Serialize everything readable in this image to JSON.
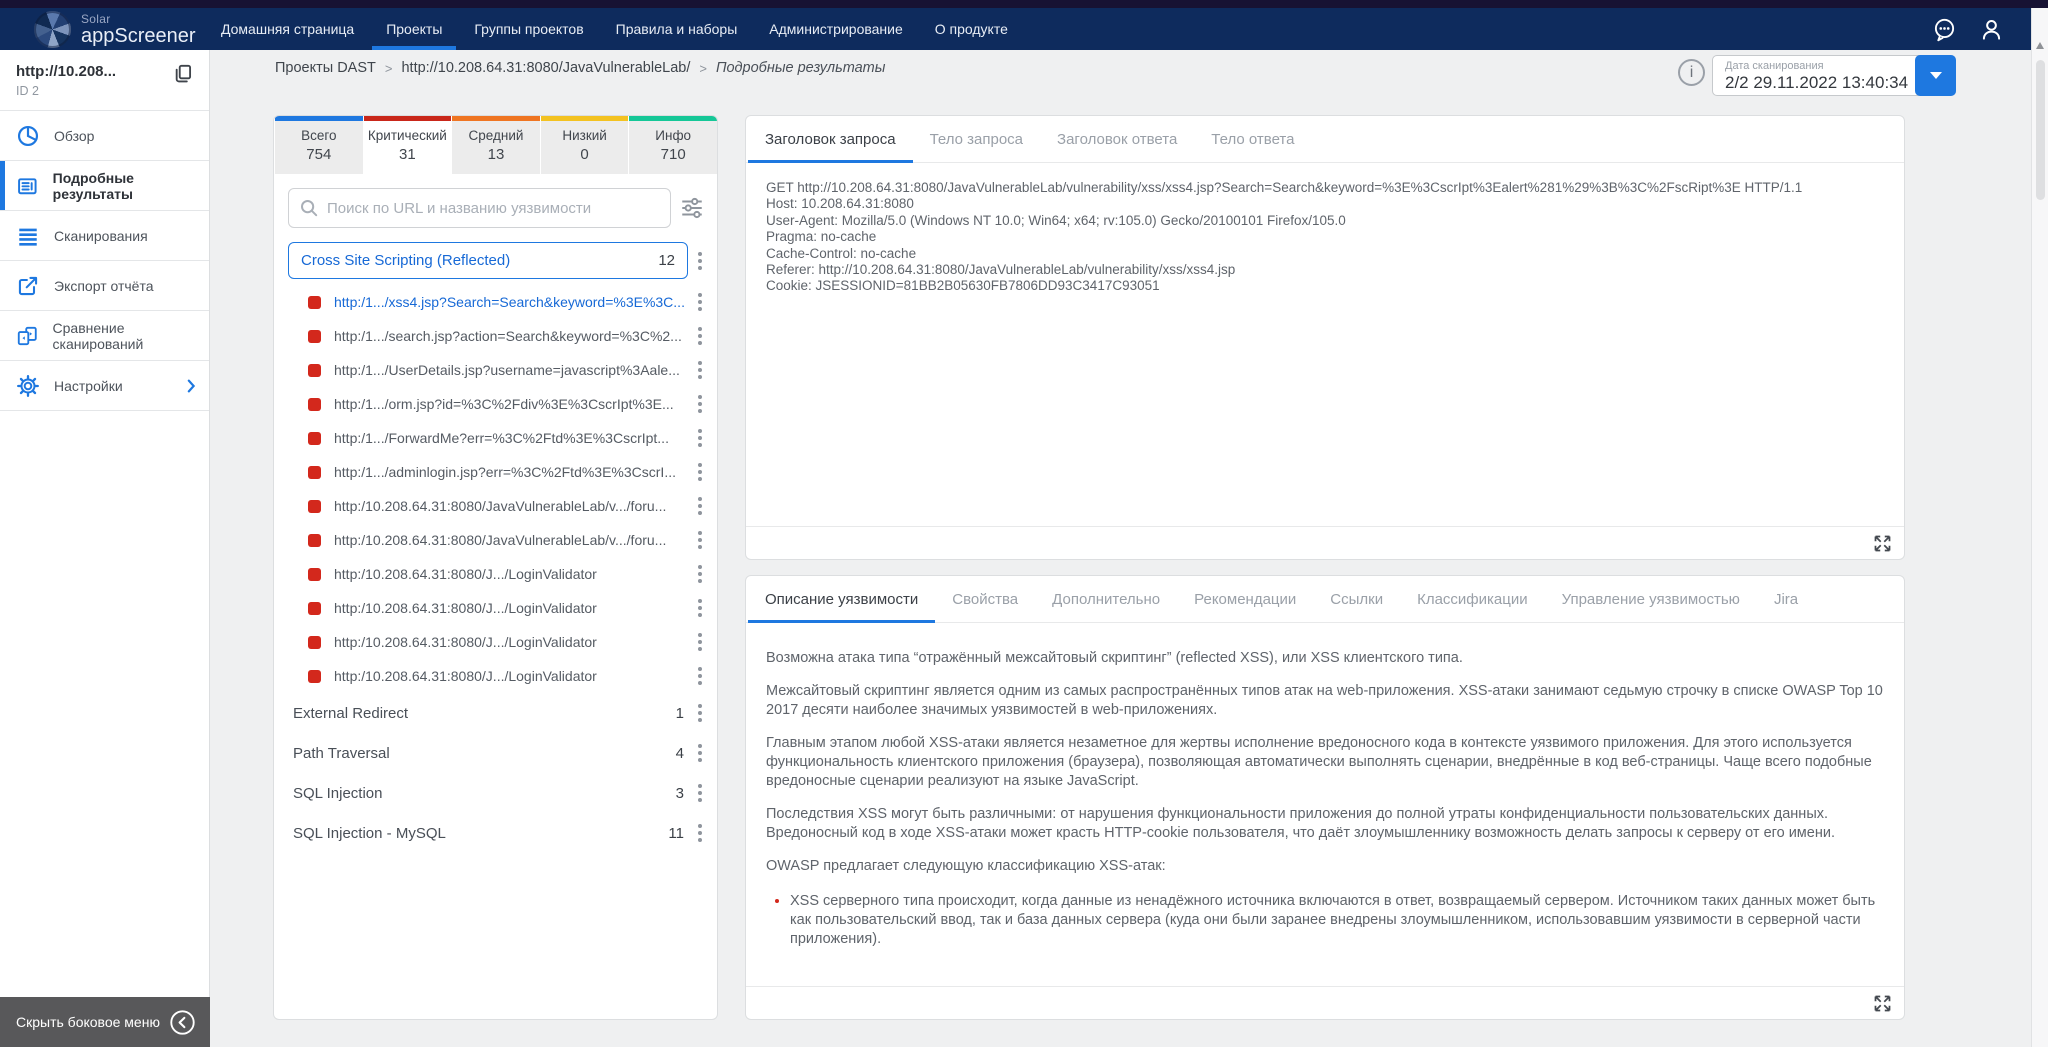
{
  "navbar": {
    "logo_line1": "Solar",
    "logo_line2": "appScreener",
    "items": [
      {
        "item_label": "Домашняя страница",
        "active": false
      },
      {
        "item_label": "Проекты",
        "active": true
      },
      {
        "item_label": "Группы проектов",
        "active": false
      },
      {
        "item_label": "Правила и наборы",
        "active": false
      },
      {
        "item_label": "Администрирование",
        "active": false
      },
      {
        "item_label": "О продукте",
        "active": false
      }
    ]
  },
  "sidebar": {
    "project": {
      "project_title": "http://10.208...",
      "project_id": "ID 2"
    },
    "items": [
      {
        "item_label": "Обзор",
        "icon": "pie-chart-icon",
        "active": false
      },
      {
        "item_label": "Подробные результаты",
        "icon": "detailed-results-icon",
        "active": true
      },
      {
        "item_label": "Сканирования",
        "icon": "scans-list-icon",
        "active": false
      },
      {
        "item_label": "Экспорт отчёта",
        "icon": "export-icon",
        "active": false
      },
      {
        "item_label": "Сравнение сканирований",
        "icon": "compare-icon",
        "active": false
      },
      {
        "item_label": "Настройки",
        "icon": "gear-icon",
        "active": false,
        "has_chevron": true
      }
    ],
    "collapse_menu": "Скрыть боковое меню"
  },
  "header": {
    "breadcrumb": {
      "crumb1": "Проекты DAST",
      "crumb2": "http://10.208.64.31:8080/JavaVulnerableLab/",
      "crumb3": "Подробные результаты"
    },
    "scan_date_label": "Дата сканирования",
    "scan_date_value": "2/2 29.11.2022 13:40:34"
  },
  "colors": {
    "accent_blue": "#1e78e0",
    "severity_total": "#1e78e0",
    "severity_critical": "#c9271a",
    "severity_medium": "#ef7522",
    "severity_low": "#f3c221",
    "severity_info": "#15c797",
    "bullet_red": "#d3281c"
  },
  "vulnerabilities": {
    "severity_tabs": [
      {
        "tab_label": "Всего",
        "tab_count": "754",
        "color": "#1e78e0",
        "active": false
      },
      {
        "tab_label": "Критический",
        "tab_count": "31",
        "color": "#c9271a",
        "active": true
      },
      {
        "tab_label": "Средний",
        "tab_count": "13",
        "color": "#ef7522",
        "active": false
      },
      {
        "tab_label": "Низкий",
        "tab_count": "0",
        "color": "#f3c221",
        "active": false
      },
      {
        "tab_label": "Инфо",
        "tab_count": "710",
        "color": "#15c797",
        "active": false
      }
    ],
    "search_placeholder": "Поиск по URL и названию уязвимости",
    "expanded_group": {
      "group_title": "Cross Site Scripting (Reflected)",
      "group_total": "12",
      "items": [
        {
          "vuln_url": "http:/1.../xss4.jsp?Search=Search&keyword=%3E%3C...",
          "selected": true
        },
        {
          "vuln_url": "http:/1.../search.jsp?action=Search&keyword=%3C%2...",
          "selected": false
        },
        {
          "vuln_url": "http:/1.../UserDetails.jsp?username=javascript%3Aale...",
          "selected": false
        },
        {
          "vuln_url": "http:/1.../orm.jsp?id=%3C%2Fdiv%3E%3CscrIpt%3E...",
          "selected": false
        },
        {
          "vuln_url": "http:/1.../ForwardMe?err=%3C%2Ftd%3E%3CscrIpt...",
          "selected": false
        },
        {
          "vuln_url": "http:/1.../adminlogin.jsp?err=%3C%2Ftd%3E%3CscrI...",
          "selected": false
        },
        {
          "vuln_url": "http:/10.208.64.31:8080/JavaVulnerableLab/v.../foru...",
          "selected": false
        },
        {
          "vuln_url": "http:/10.208.64.31:8080/JavaVulnerableLab/v.../foru...",
          "selected": false
        },
        {
          "vuln_url": "http:/10.208.64.31:8080/J.../LoginValidator",
          "selected": false
        },
        {
          "vuln_url": "http:/10.208.64.31:8080/J.../LoginValidator",
          "selected": false
        },
        {
          "vuln_url": "http:/10.208.64.31:8080/J.../LoginValidator",
          "selected": false
        },
        {
          "vuln_url": "http:/10.208.64.31:8080/J.../LoginValidator",
          "selected": false
        }
      ]
    },
    "collapsed_groups": [
      {
        "group_title": "External Redirect",
        "group_total": "1"
      },
      {
        "group_title": "Path Traversal",
        "group_total": "4"
      },
      {
        "group_title": "SQL Injection",
        "group_total": "3"
      },
      {
        "group_title": "SQL Injection - MySQL",
        "group_total": "11"
      }
    ]
  },
  "request_panel": {
    "tabs": [
      {
        "tab_label": "Заголовок запроса",
        "active": true
      },
      {
        "tab_label": "Тело запроса",
        "active": false
      },
      {
        "tab_label": "Заголовок ответа",
        "active": false
      },
      {
        "tab_label": "Тело ответа",
        "active": false
      }
    ],
    "lines": [
      "GET http://10.208.64.31:8080/JavaVulnerableLab/vulnerability/xss/xss4.jsp?Search=Search&keyword=%3E%3CscrIpt%3Ealert%281%29%3B%3C%2FscRipt%3E HTTP/1.1",
      "Host: 10.208.64.31:8080",
      "User-Agent: Mozilla/5.0 (Windows NT 10.0; Win64; x64; rv:105.0) Gecko/20100101 Firefox/105.0",
      "Pragma: no-cache",
      "Cache-Control: no-cache",
      "Referer: http://10.208.64.31:8080/JavaVulnerableLab/vulnerability/xss/xss4.jsp",
      "Cookie: JSESSIONID=81BB2B05630FB7806DD93C3417C93051"
    ]
  },
  "description_panel": {
    "tabs": [
      {
        "tab_label": "Описание уязвимости",
        "active": true
      },
      {
        "tab_label": "Свойства",
        "active": false
      },
      {
        "tab_label": "Дополнительно",
        "active": false
      },
      {
        "tab_label": "Рекомендации",
        "active": false
      },
      {
        "tab_label": "Ссылки",
        "active": false
      },
      {
        "tab_label": "Классификации",
        "active": false
      },
      {
        "tab_label": "Управление уязвимостью",
        "active": false
      },
      {
        "tab_label": "Jira",
        "active": false
      }
    ],
    "paragraphs": [
      "Возможна атака типа “отражённый межсайтовый скриптинг” (reflected XSS), или XSS клиентского типа.",
      "Межсайтовый скриптинг является одним из самых распространённых типов атак на web-приложения. XSS-атаки занимают седьмую строчку в списке OWASP Top 10 2017 десяти наиболее значимых уязвимостей в web-приложениях.",
      "Главным этапом любой XSS-атаки является незаметное для жертвы исполнение вредоносного кода в контексте уязвимого приложения. Для этого используется функциональность клиентского приложения (браузера), позволяющая автоматически выполнять сценарии, внедрённые в код веб-страницы. Чаще всего подобные вредоносные сценарии реализуют на языке JavaScript.",
      "Последствия XSS могут быть различными: от нарушения функциональности приложения до полной утраты конфиденциальности пользовательских данных. Вредоносный код в ходе XSS-атаки может красть HTTP-cookie пользователя, что даёт злоумышленнику возможность делать запросы к серверу от его имени.",
      "OWASP предлагает следующую классификацию XSS-атак:"
    ],
    "bullets": [
      "XSS серверного типа происходит, когда данные из ненадёжного источника включаются в ответ, возвращаемый сервером. Источником таких данных может быть как пользовательский ввод, так и база данных сервера (куда они были заранее внедрены злоумышленником, использовавшим уязвимости в серверной части приложения)."
    ]
  }
}
